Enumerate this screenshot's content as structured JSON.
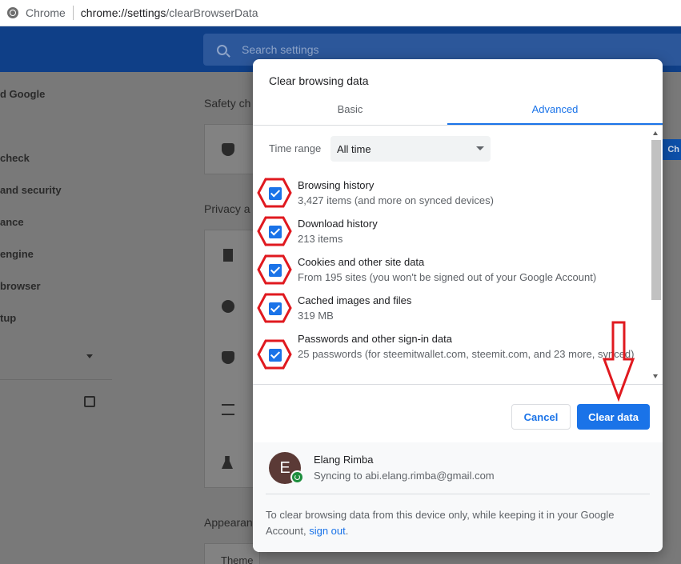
{
  "browser": {
    "app_name": "Chrome",
    "url_host": "chrome://settings",
    "url_path": "/clearBrowserData"
  },
  "settings_bg": {
    "search_placeholder": "Search settings",
    "sidebar": [
      {
        "label": "d Google"
      },
      {
        "label": "check"
      },
      {
        "label": " and security"
      },
      {
        "label": "ance"
      },
      {
        "label": "engine"
      },
      {
        "label": " browser"
      },
      {
        "label": "tup"
      }
    ],
    "sections": {
      "safety": "Safety ch",
      "privacy": "Privacy a",
      "appearance": "Appearan",
      "theme": "Theme"
    },
    "edge_button": "Ch"
  },
  "dialog": {
    "title": "Clear browsing data",
    "tabs": [
      {
        "label": "Basic",
        "active": false
      },
      {
        "label": "Advanced",
        "active": true
      }
    ],
    "time_range": {
      "label": "Time range",
      "value": "All time"
    },
    "items": [
      {
        "title": "Browsing history",
        "subtitle": "3,427 items (and more on synced devices)",
        "checked": true
      },
      {
        "title": "Download history",
        "subtitle": "213 items",
        "checked": true
      },
      {
        "title": "Cookies and other site data",
        "subtitle": "From 195 sites (you won't be signed out of your Google Account)",
        "checked": true
      },
      {
        "title": "Cached images and files",
        "subtitle": "319 MB",
        "checked": true
      },
      {
        "title": "Passwords and other sign-in data",
        "subtitle": "25 passwords (for steemitwallet.com, steemit.com, and 23 more, synced)",
        "checked": true
      }
    ],
    "buttons": {
      "cancel": "Cancel",
      "clear": "Clear data"
    },
    "account": {
      "initial": "E",
      "name": "Elang Rimba",
      "sync_text": "Syncing to abi.elang.rimba@gmail.com"
    },
    "footer_note": "To clear browsing data from this device only, while keeping it in your Google Account, ",
    "sign_out": "sign out",
    "footer_note_end": "."
  },
  "colors": {
    "accent": "#1a73e8",
    "annotation": "#e0191f"
  }
}
